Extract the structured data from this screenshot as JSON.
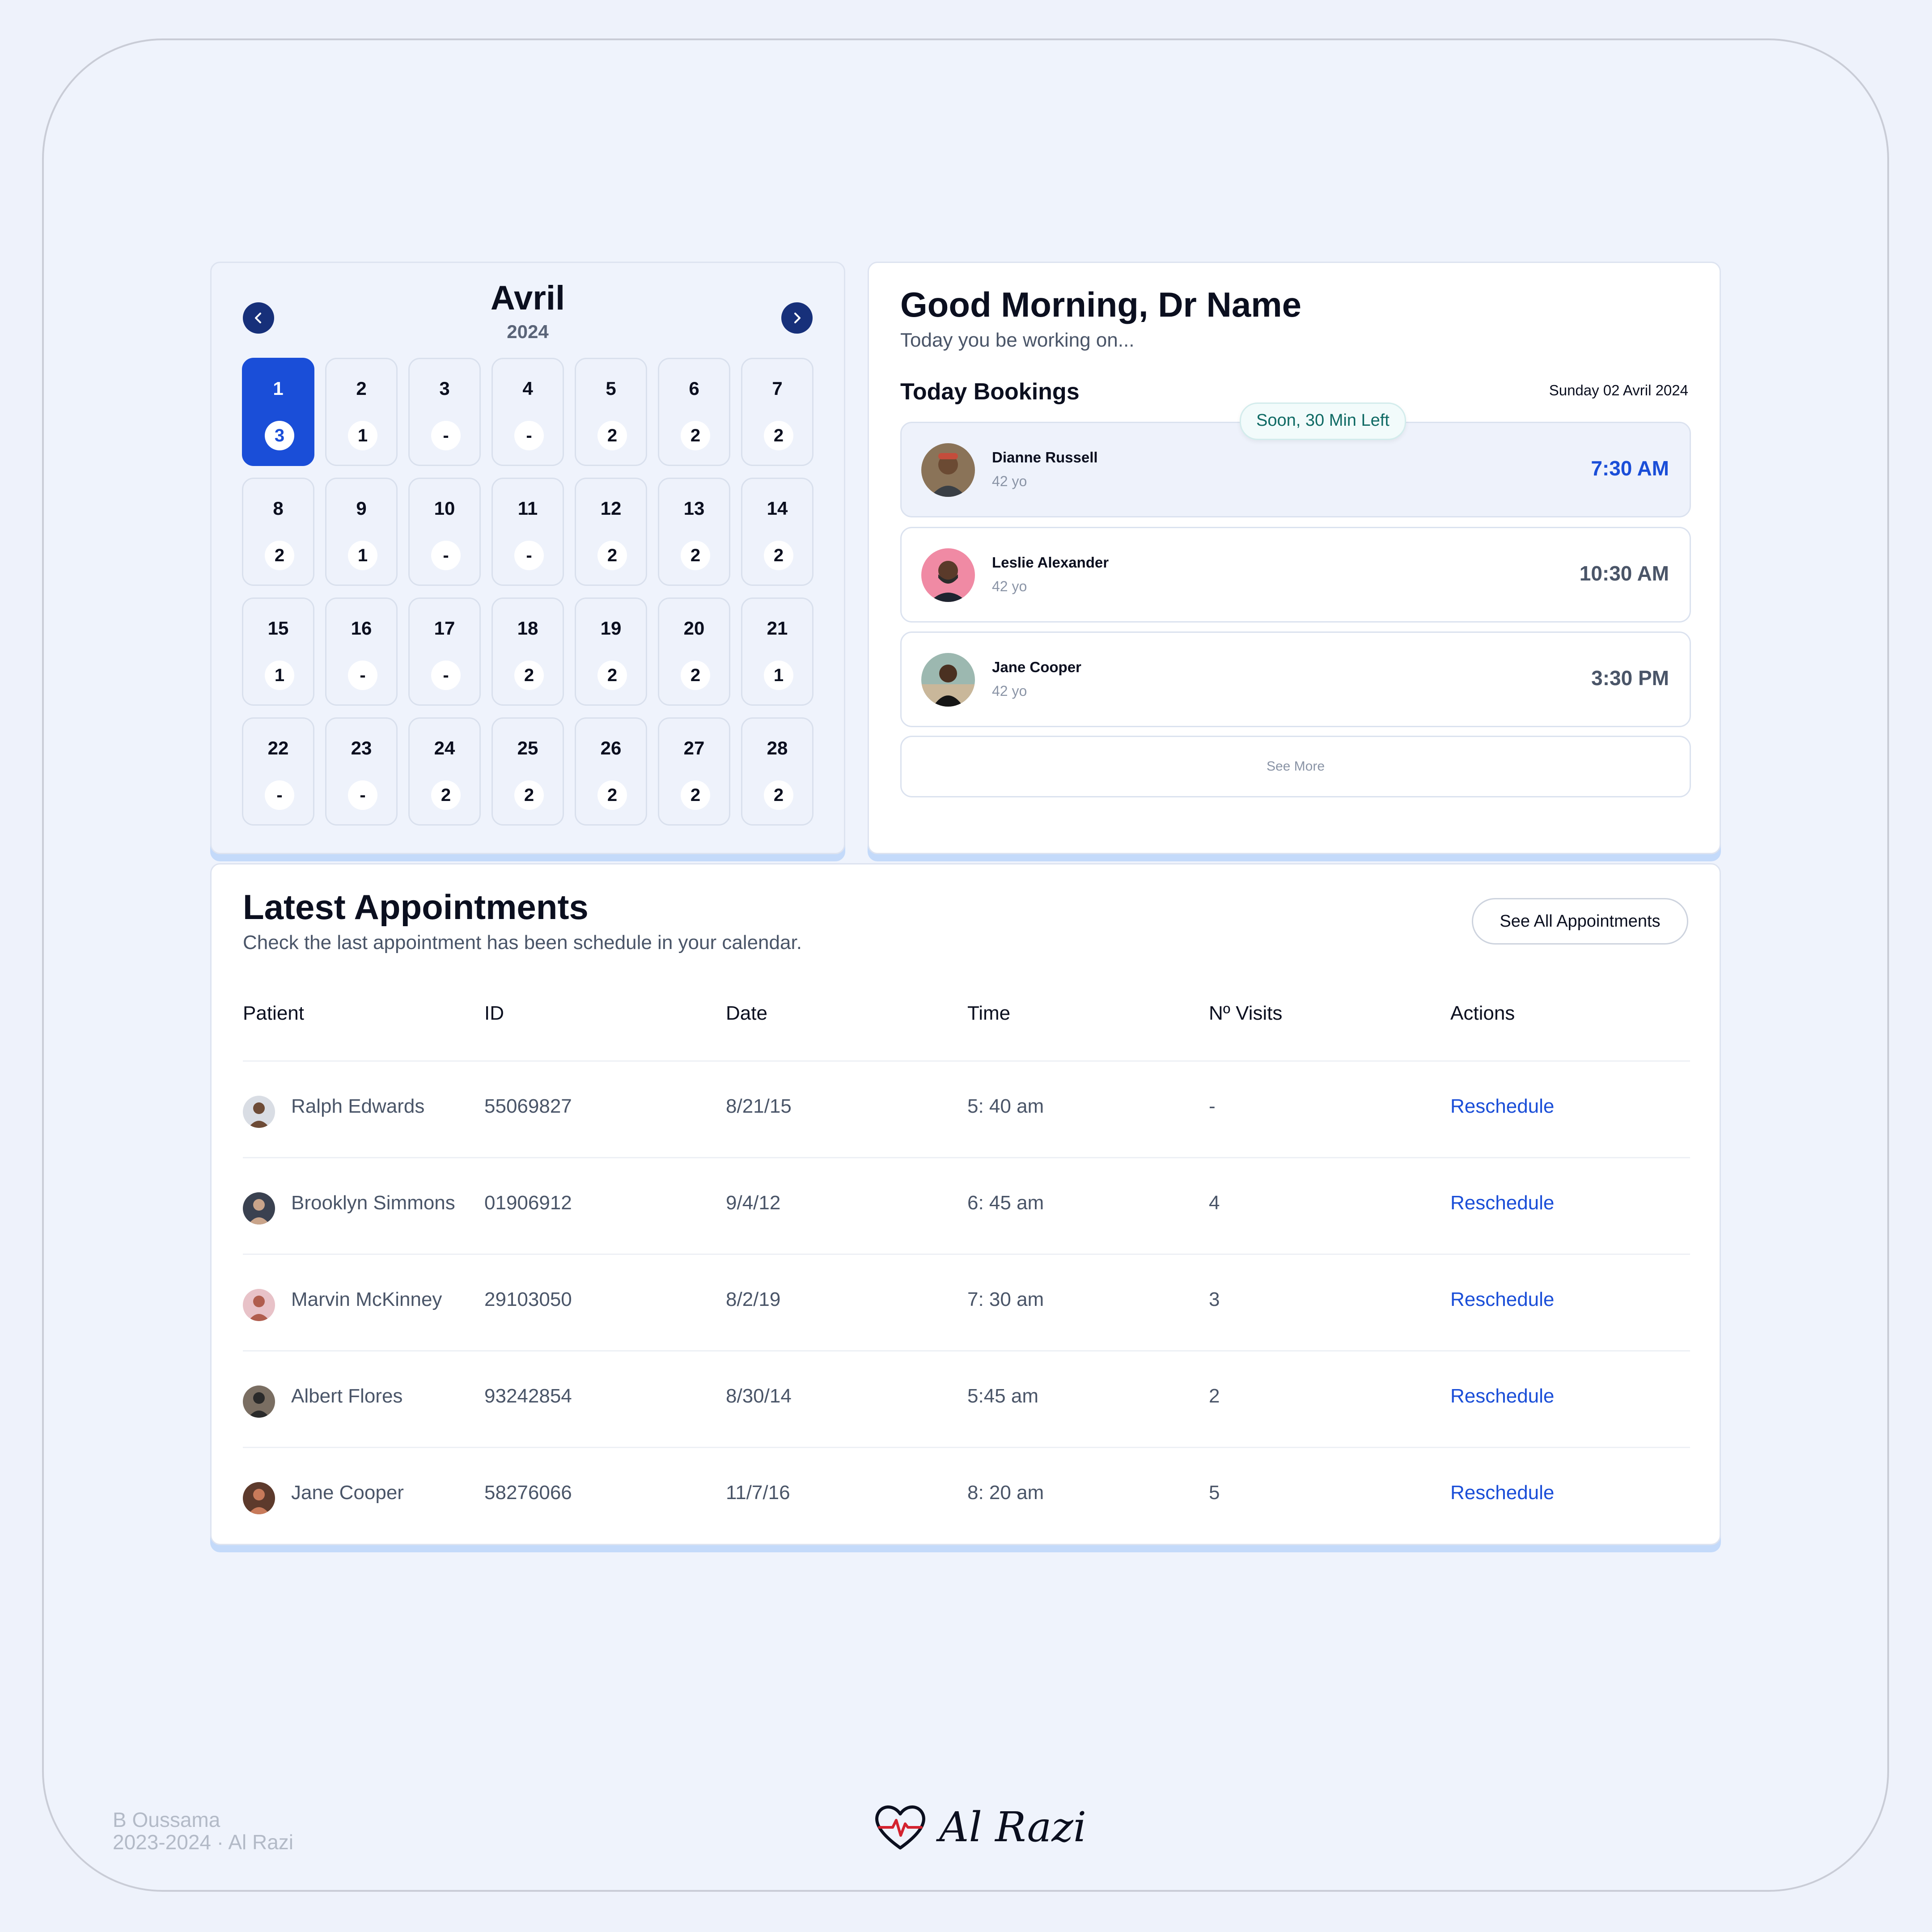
{
  "calendar": {
    "month": "Avril",
    "year": "2024",
    "prev_icon": "chevron-left-icon",
    "next_icon": "chevron-right-icon",
    "days": [
      {
        "day": "1",
        "count": "3",
        "active": true
      },
      {
        "day": "2",
        "count": "1"
      },
      {
        "day": "3",
        "count": "-"
      },
      {
        "day": "4",
        "count": "-"
      },
      {
        "day": "5",
        "count": "2"
      },
      {
        "day": "6",
        "count": "2"
      },
      {
        "day": "7",
        "count": "2"
      },
      {
        "day": "8",
        "count": "2"
      },
      {
        "day": "9",
        "count": "1"
      },
      {
        "day": "10",
        "count": "-"
      },
      {
        "day": "11",
        "count": "-"
      },
      {
        "day": "12",
        "count": "2"
      },
      {
        "day": "13",
        "count": "2"
      },
      {
        "day": "14",
        "count": "2"
      },
      {
        "day": "15",
        "count": "1"
      },
      {
        "day": "16",
        "count": "-"
      },
      {
        "day": "17",
        "count": "-"
      },
      {
        "day": "18",
        "count": "2"
      },
      {
        "day": "19",
        "count": "2"
      },
      {
        "day": "20",
        "count": "2"
      },
      {
        "day": "21",
        "count": "1"
      },
      {
        "day": "22",
        "count": "-"
      },
      {
        "day": "23",
        "count": "-"
      },
      {
        "day": "24",
        "count": "2"
      },
      {
        "day": "25",
        "count": "2"
      },
      {
        "day": "26",
        "count": "2"
      },
      {
        "day": "27",
        "count": "2"
      },
      {
        "day": "28",
        "count": "2"
      }
    ]
  },
  "greeting": {
    "title": "Good Morning, Dr Name",
    "subtitle": "Today you be working on..."
  },
  "bookings": {
    "title": "Today Bookings",
    "date": "Sunday 02 Avril 2024",
    "badge": "Soon, 30 Min Left",
    "items": [
      {
        "name": "Dianne Russell",
        "age": "42 yo",
        "time": "7:30 AM"
      },
      {
        "name": "Leslie Alexander",
        "age": "42 yo",
        "time": "10:30 AM"
      },
      {
        "name": "Jane Cooper",
        "age": "42 yo",
        "time": "3:30 PM"
      }
    ],
    "see_more": "See More"
  },
  "appointments": {
    "title": "Latest Appointments",
    "subtitle": "Check the last appointment has been schedule in your calendar.",
    "see_all": "See All Appointments",
    "columns": [
      "Patient",
      "ID",
      "Date",
      "Time",
      "Nº Visits",
      "Actions"
    ],
    "rows": [
      {
        "patient": "Ralph Edwards",
        "id": "55069827",
        "date": "8/21/15",
        "time": "5: 40 am",
        "visits": "-",
        "action": "Reschedule"
      },
      {
        "patient": "Brooklyn Simmons",
        "id": "01906912",
        "date": "9/4/12",
        "time": "6: 45 am",
        "visits": "4",
        "action": "Reschedule"
      },
      {
        "patient": "Marvin McKinney",
        "id": "29103050",
        "date": "8/2/19",
        "time": "7: 30 am",
        "visits": "3",
        "action": "Reschedule"
      },
      {
        "patient": "Albert Flores",
        "id": "93242854",
        "date": "8/30/14",
        "time": "5:45 am",
        "visits": "2",
        "action": "Reschedule"
      },
      {
        "patient": "Jane Cooper",
        "id": "58276066",
        "date": "11/7/16",
        "time": "8: 20 am",
        "visits": "5",
        "action": "Reschedule"
      }
    ]
  },
  "footer": {
    "author": "B Oussama",
    "credit": "2023-2024 · Al Razi",
    "logo_text": "Al Razi",
    "logo_icon": "heart-pulse-icon"
  },
  "colors": {
    "accent": "#1a4ed8",
    "nav": "#17307a",
    "background": "#eff3fc",
    "card_shadow": "#c4dafa"
  }
}
